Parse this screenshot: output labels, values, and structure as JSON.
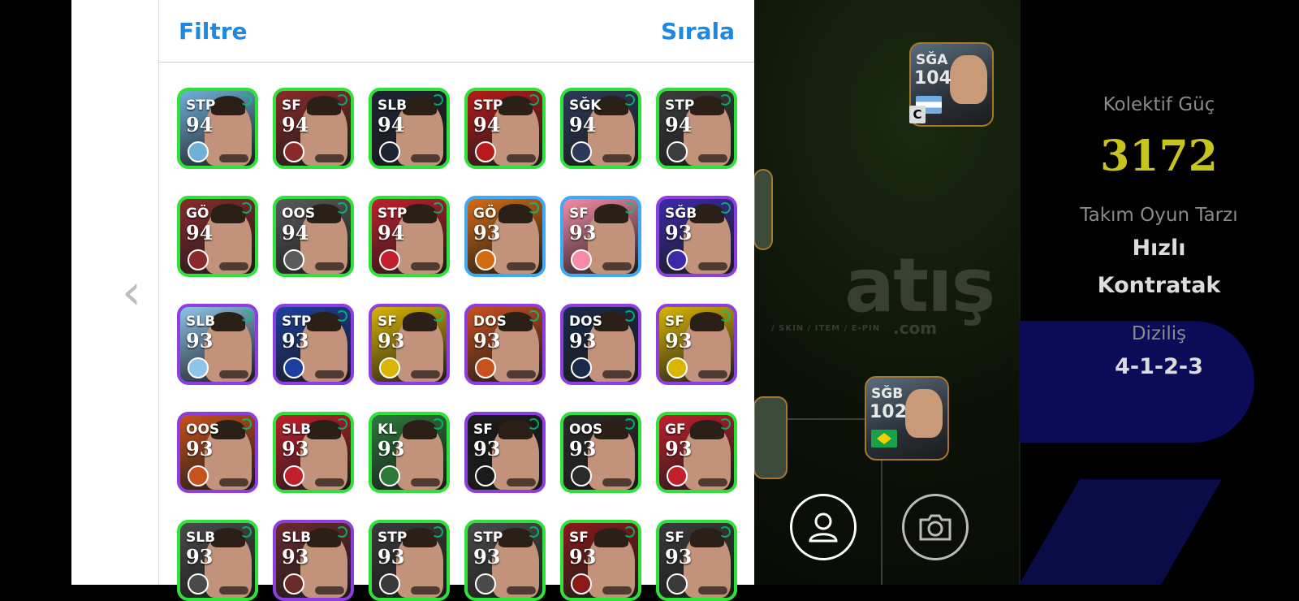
{
  "panel": {
    "filter_label": "Filtre",
    "sort_label": "Sırala"
  },
  "background": {
    "watermark": "atış",
    "watermark_suffix": ".com",
    "watermark_sub": "/ SKIN / ITEM / E-PIN",
    "captain_badge": "C",
    "cards": [
      {
        "pos": "SĞA",
        "ovr": "104",
        "flag": "argentina"
      },
      {
        "pos": "SĞB",
        "ovr": "102",
        "flag": "brazil"
      }
    ]
  },
  "stats": {
    "kolektif_label": "Kolektif Güç",
    "kolektif_value": "3172",
    "oyun_label": "Takım Oyun Tarzı",
    "oyun_value_line1": "Hızlı",
    "oyun_value_line2": "Kontratak",
    "dizilis_label": "Diziliş",
    "dizilis_value": "4-1-2-3"
  },
  "colors": {
    "accent_blue": "#1e88e5",
    "rarity_green": "#2ee23a",
    "rarity_purple": "#8d3ee0",
    "gold_value": "#c8c41e"
  },
  "icons": {
    "profile": "profile-icon",
    "camera": "camera-icon",
    "back": "chevron-left-icon"
  },
  "cards": [
    [
      {
        "pos": "STP",
        "ovr": "94",
        "rarity": "green",
        "bg": "#6fb0d8"
      },
      {
        "pos": "SF",
        "ovr": "94",
        "rarity": "green",
        "bg": "#8a2a2a"
      },
      {
        "pos": "SLB",
        "ovr": "94",
        "rarity": "green",
        "bg": "#1f2433"
      },
      {
        "pos": "STP",
        "ovr": "94",
        "rarity": "green",
        "bg": "#b61a1a"
      },
      {
        "pos": "SĞK",
        "ovr": "94",
        "rarity": "green",
        "bg": "#2c3a5a"
      },
      {
        "pos": "STP",
        "ovr": "94",
        "rarity": "green",
        "bg": "#3c3c3c"
      }
    ],
    [
      {
        "pos": "GÖ",
        "ovr": "94",
        "rarity": "green",
        "bg": "#8a2a2a"
      },
      {
        "pos": "OOS",
        "ovr": "94",
        "rarity": "green",
        "bg": "#5a5a5a"
      },
      {
        "pos": "STP",
        "ovr": "94",
        "rarity": "green",
        "bg": "#c21f2d"
      },
      {
        "pos": "GÖ",
        "ovr": "93",
        "rarity": "blue",
        "bg": "#d46a12"
      },
      {
        "pos": "SF",
        "ovr": "93",
        "rarity": "blue",
        "bg": "#f58ba6"
      },
      {
        "pos": "SĞB",
        "ovr": "93",
        "rarity": "purple",
        "bg": "#3b2aa8"
      }
    ],
    [
      {
        "pos": "SLB",
        "ovr": "93",
        "rarity": "purple",
        "bg": "#8ec3ea"
      },
      {
        "pos": "STP",
        "ovr": "93",
        "rarity": "purple",
        "bg": "#1c3f9e"
      },
      {
        "pos": "SF",
        "ovr": "93",
        "rarity": "purple",
        "bg": "#d9b400"
      },
      {
        "pos": "DOS",
        "ovr": "93",
        "rarity": "purple",
        "bg": "#c8501c"
      },
      {
        "pos": "DOS",
        "ovr": "93",
        "rarity": "purple",
        "bg": "#1a2a4a"
      },
      {
        "pos": "SF",
        "ovr": "93",
        "rarity": "purple",
        "bg": "#d9b400"
      }
    ],
    [
      {
        "pos": "OOS",
        "ovr": "93",
        "rarity": "purple",
        "bg": "#c8501c"
      },
      {
        "pos": "SLB",
        "ovr": "93",
        "rarity": "green",
        "bg": "#c21f2d"
      },
      {
        "pos": "KL",
        "ovr": "93",
        "rarity": "green",
        "bg": "#2b7a3a"
      },
      {
        "pos": "SF",
        "ovr": "93",
        "rarity": "purple",
        "bg": "#1a1a1a"
      },
      {
        "pos": "OOS",
        "ovr": "93",
        "rarity": "green",
        "bg": "#2a2a2a"
      },
      {
        "pos": "GF",
        "ovr": "93",
        "rarity": "green",
        "bg": "#c21f2d"
      }
    ],
    [
      {
        "pos": "SLB",
        "ovr": "93",
        "rarity": "green",
        "bg": "#4a4a4a"
      },
      {
        "pos": "SLB",
        "ovr": "93",
        "rarity": "purple",
        "bg": "#6a2a2a"
      },
      {
        "pos": "STP",
        "ovr": "93",
        "rarity": "green",
        "bg": "#3a3a3a"
      },
      {
        "pos": "STP",
        "ovr": "93",
        "rarity": "green",
        "bg": "#4a4a4a"
      },
      {
        "pos": "SF",
        "ovr": "93",
        "rarity": "green",
        "bg": "#8a1a1a"
      },
      {
        "pos": "SF",
        "ovr": "93",
        "rarity": "green",
        "bg": "#3a3a3a"
      }
    ]
  ]
}
